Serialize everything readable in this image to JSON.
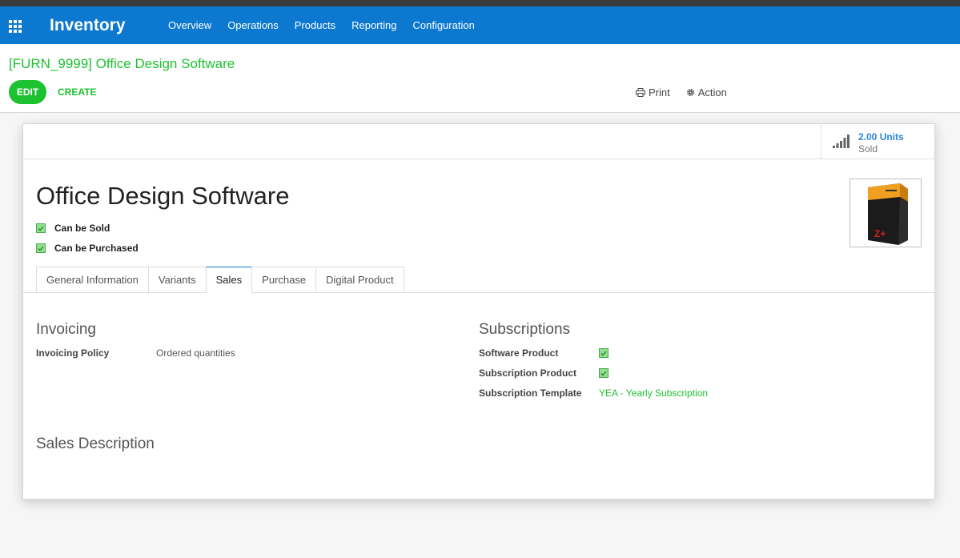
{
  "navbar": {
    "app_name": "Inventory",
    "menu": [
      "Overview",
      "Operations",
      "Products",
      "Reporting",
      "Configuration"
    ]
  },
  "control_panel": {
    "breadcrumb": "[FURN_9999] Office Design Software",
    "edit_label": "EDIT",
    "create_label": "CREATE",
    "print_label": "Print",
    "action_label": "Action"
  },
  "stat": {
    "value": "2.00 Units",
    "label": "Sold"
  },
  "product": {
    "name": "Office Design Software",
    "can_be_sold": "Can be Sold",
    "can_be_purchased": "Can be Purchased"
  },
  "tabs": [
    "General Information",
    "Variants",
    "Sales",
    "Purchase",
    "Digital Product"
  ],
  "active_tab": "Sales",
  "sales": {
    "invoicing_title": "Invoicing",
    "invoicing_policy_label": "Invoicing Policy",
    "invoicing_policy_value": "Ordered quantities",
    "subscriptions_title": "Subscriptions",
    "software_product_label": "Software Product",
    "subscription_product_label": "Subscription Product",
    "subscription_template_label": "Subscription Template",
    "subscription_template_value": "YEA - Yearly Subscription",
    "sales_description_title": "Sales Description"
  },
  "colors": {
    "navbar": "#0c78d0",
    "accent_green": "#1cc22f",
    "stat_blue": "#2e86d6"
  },
  "icons": {
    "apps": "apps-grid-icon",
    "print": "print-icon",
    "action": "gear-icon",
    "stat": "signal-bars-icon"
  }
}
